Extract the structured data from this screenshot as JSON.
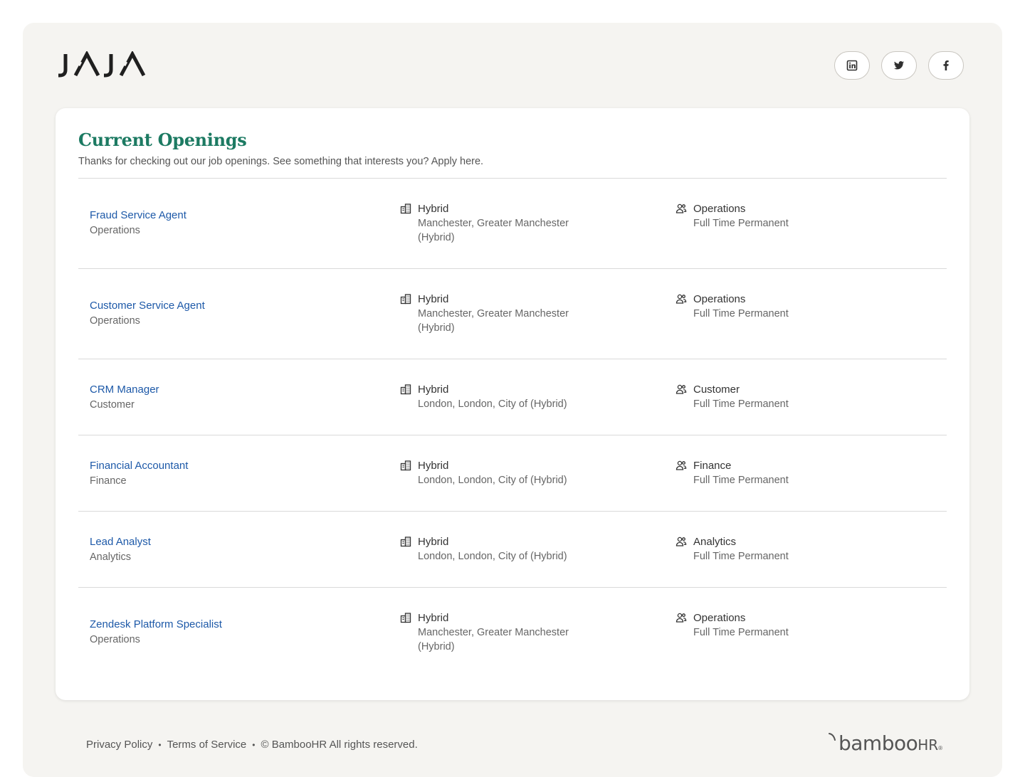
{
  "brand": {
    "logo_text": "J/\\J/\\"
  },
  "social": [
    {
      "name": "linkedin-icon",
      "label": "in"
    },
    {
      "name": "twitter-icon",
      "label": ""
    },
    {
      "name": "facebook-icon",
      "label": "f"
    }
  ],
  "openings": {
    "title": "Current Openings",
    "subtitle": "Thanks for checking out our job openings. See something that interests you? Apply here.",
    "jobs": [
      {
        "title": "Fraud Service Agent",
        "department": "Operations",
        "location_type": "Hybrid",
        "location": "Manchester, Greater Manchester (Hybrid)",
        "team": "Operations",
        "employment": "Full Time Permanent"
      },
      {
        "title": "Customer Service Agent",
        "department": "Operations",
        "location_type": "Hybrid",
        "location": "Manchester, Greater Manchester (Hybrid)",
        "team": "Operations",
        "employment": "Full Time Permanent"
      },
      {
        "title": "CRM Manager",
        "department": "Customer",
        "location_type": "Hybrid",
        "location": "London, London, City of (Hybrid)",
        "team": "Customer",
        "employment": "Full Time Permanent"
      },
      {
        "title": "Financial Accountant",
        "department": "Finance",
        "location_type": "Hybrid",
        "location": "London, London, City of (Hybrid)",
        "team": "Finance",
        "employment": "Full Time Permanent"
      },
      {
        "title": "Lead Analyst",
        "department": "Analytics",
        "location_type": "Hybrid",
        "location": "London, London, City of (Hybrid)",
        "team": "Analytics",
        "employment": "Full Time Permanent"
      },
      {
        "title": "Zendesk Platform Specialist",
        "department": "Operations",
        "location_type": "Hybrid",
        "location": "Manchester, Greater Manchester (Hybrid)",
        "team": "Operations",
        "employment": "Full Time Permanent"
      }
    ]
  },
  "footer": {
    "privacy": "Privacy Policy",
    "terms": "Terms of Service",
    "copyright": "© BambooHR All rights reserved.",
    "separator": "•",
    "brand_left": "bamboo",
    "brand_right": "HR",
    "brand_tm": "®"
  }
}
